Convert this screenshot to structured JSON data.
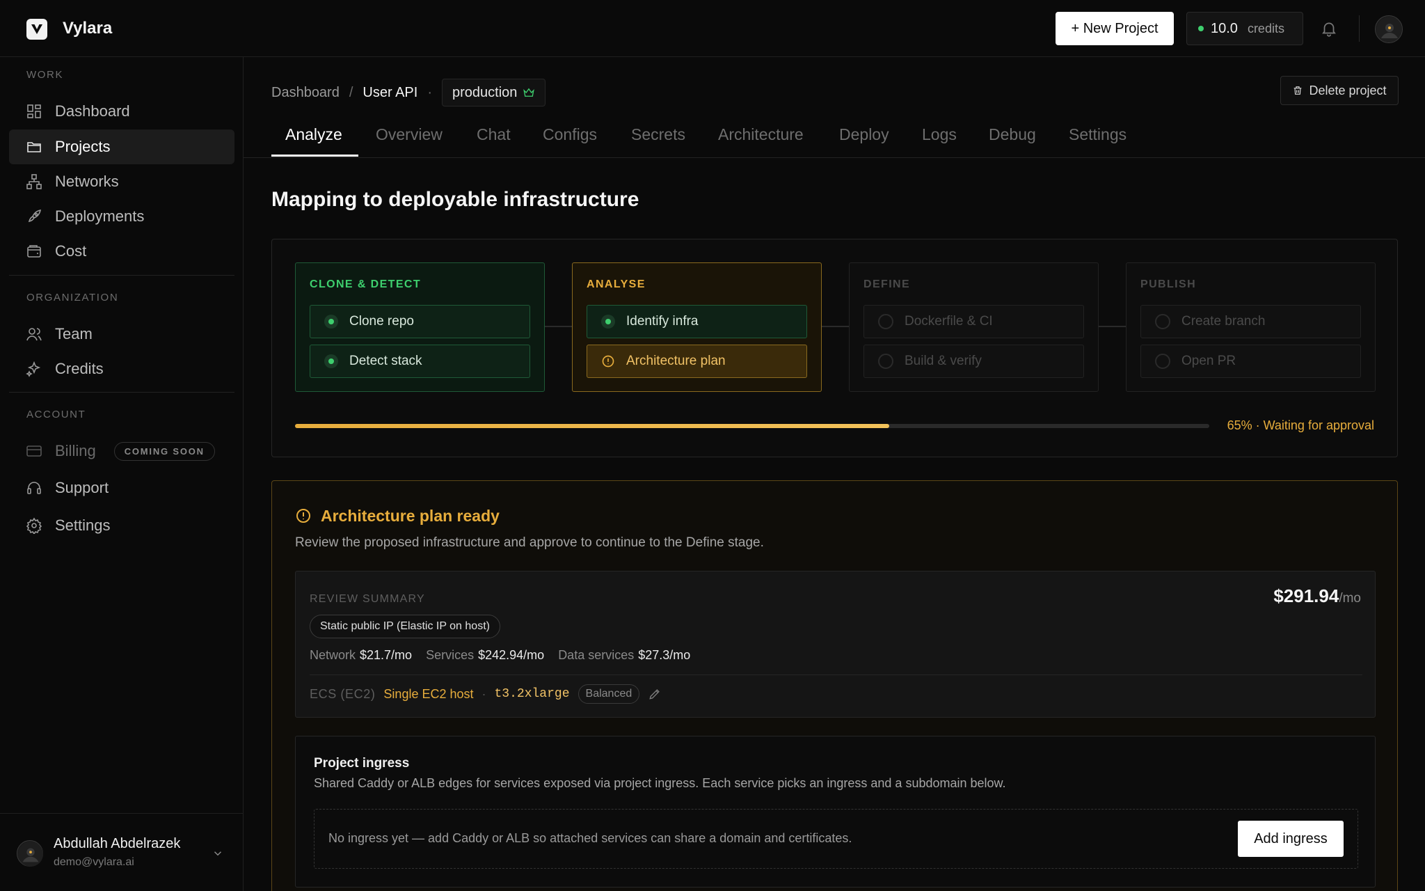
{
  "app": {
    "name": "Vylara"
  },
  "topbar": {
    "new_project_label": "+ New Project",
    "credits_value": "10.0",
    "credits_label": "credits",
    "icons": [
      "bell-icon",
      "avatar"
    ]
  },
  "sidebar": {
    "sections": {
      "work": "WORK",
      "organization": "ORGANIZATION",
      "account": "ACCOUNT"
    },
    "items": [
      {
        "label": "Dashboard",
        "icon": "dashboard-icon"
      },
      {
        "label": "Projects",
        "icon": "folder-icon",
        "active": true
      },
      {
        "label": "Networks",
        "icon": "network-icon"
      },
      {
        "label": "Deployments",
        "icon": "rocket-icon"
      },
      {
        "label": "Cost",
        "icon": "wallet-icon"
      },
      {
        "label": "Team",
        "icon": "users-icon"
      },
      {
        "label": "Credits",
        "icon": "sparkles-icon"
      },
      {
        "label": "Billing",
        "icon": "card-icon",
        "badge": "COMING SOON"
      },
      {
        "label": "Support",
        "icon": "headset-icon"
      },
      {
        "label": "Settings",
        "icon": "gear-icon"
      }
    ],
    "user": {
      "name": "Abdullah Abdelrazek",
      "email": "demo@vylara.ai"
    }
  },
  "breadcrumb": {
    "root": "Dashboard",
    "separator": "/",
    "current": "User API",
    "dot": "·",
    "environment": "production"
  },
  "header": {
    "delete_label": "Delete project"
  },
  "tabs": [
    {
      "label": "Analyze",
      "active": true
    },
    {
      "label": "Overview"
    },
    {
      "label": "Chat"
    },
    {
      "label": "Configs"
    },
    {
      "label": "Secrets"
    },
    {
      "label": "Architecture"
    },
    {
      "label": "Deploy"
    },
    {
      "label": "Logs"
    },
    {
      "label": "Debug"
    },
    {
      "label": "Settings"
    }
  ],
  "page": {
    "title": "Mapping to deployable infrastructure"
  },
  "pipeline": {
    "stages": [
      {
        "title": "CLONE & DETECT",
        "state": "done",
        "steps": [
          "Clone repo",
          "Detect stack"
        ]
      },
      {
        "title": "ANALYSE",
        "state": "current",
        "steps": [
          "Identify infra",
          "Architecture plan"
        ]
      },
      {
        "title": "DEFINE",
        "state": "pending",
        "steps": [
          "Dockerfile & CI",
          "Build & verify"
        ]
      },
      {
        "title": "PUBLISH",
        "state": "pending",
        "steps": [
          "Create branch",
          "Open PR"
        ]
      }
    ],
    "progress_percent": 65,
    "progress_text": "65% · Waiting for approval",
    "colors": {
      "done": "#3ecf6e",
      "current": "#e7ad3c"
    }
  },
  "plan": {
    "title": "Architecture plan ready",
    "subtitle": "Review the proposed infrastructure and approve to continue to the Define stage.",
    "review": {
      "label": "REVIEW SUMMARY",
      "price": "$291.94",
      "price_unit": "/mo",
      "ip_tag": "Static public IP (Elastic IP on host)",
      "costs": [
        {
          "key": "Network",
          "value": "$21.7/mo"
        },
        {
          "key": "Services",
          "value": "$242.94/mo"
        },
        {
          "key": "Data services",
          "value": "$27.3/mo"
        }
      ],
      "ecs": {
        "label": "ECS (EC2)",
        "host": "Single EC2 host",
        "dot": "·",
        "instance_type": "t3.2xlarge",
        "profile": "Balanced"
      }
    },
    "ingress": {
      "title": "Project ingress",
      "subtitle": "Shared Caddy or ALB edges for services exposed via project ingress. Each service picks an ingress and a subdomain below.",
      "empty_text": "No ingress yet — add Caddy or ALB so attached services can share a domain and certificates.",
      "add_label": "Add ingress"
    }
  }
}
